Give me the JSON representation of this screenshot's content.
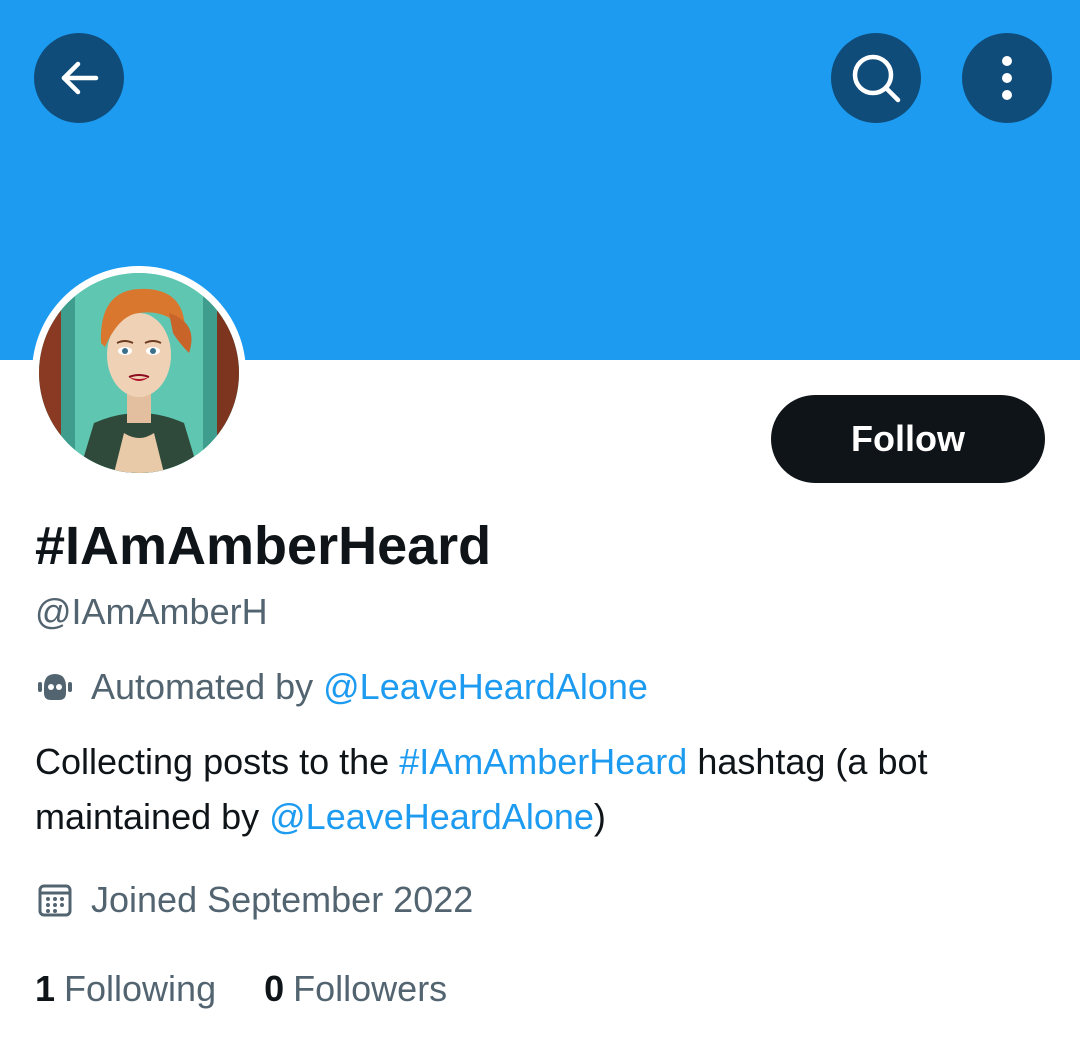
{
  "header": {
    "back_icon": "arrow-left-icon",
    "search_icon": "search-icon",
    "more_icon": "more-vertical-icon",
    "banner_color": "#1d9bf0",
    "button_bg_color": "#0f4c7a"
  },
  "profile": {
    "display_name": "#IAmAmberHeard",
    "handle": "@IAmAmberH",
    "follow_label": "Follow",
    "automated": {
      "icon": "bot-icon",
      "prefix": "Automated by ",
      "account": "@LeaveHeardAlone"
    },
    "bio": {
      "part1": "Collecting posts to the ",
      "hashtag": "#IAmAmberHeard",
      "part2": " hashtag (a bot maintained by ",
      "mention": "@LeaveHeardAlone",
      "part3": ")"
    },
    "joined": {
      "icon": "calendar-icon",
      "text": "Joined September 2022"
    },
    "stats": {
      "following_count": "1",
      "following_label": "Following",
      "followers_count": "0",
      "followers_label": "Followers"
    }
  },
  "colors": {
    "accent": "#1d9bf0",
    "text_primary": "#0f1419",
    "text_secondary": "#536471",
    "follow_button": "#0f1419"
  }
}
